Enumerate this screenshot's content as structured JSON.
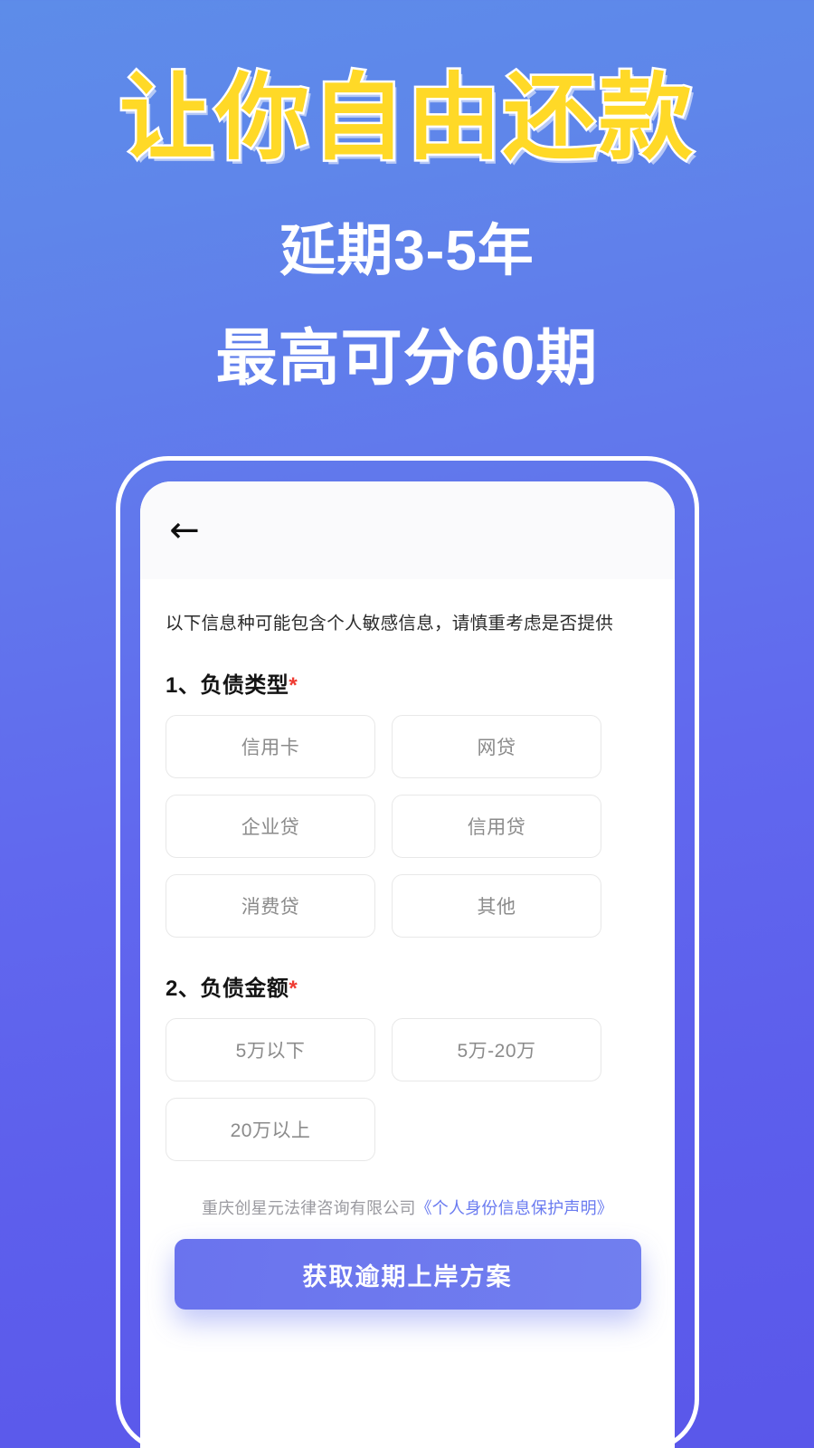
{
  "hero": {
    "headline": "让你自由还款",
    "subline_1": "延期3-5年",
    "subline_2": "最高可分60期",
    "headline_color": "#ffd927",
    "headline_stroke_color": "#ffffff",
    "subline_color": "#ffffff",
    "background_gradient_from": "#5d8ce9",
    "background_gradient_to": "#5a57ea"
  },
  "phone": {
    "header": {
      "back_icon": "←"
    },
    "notice": "以下信息种可能包含个人敏感信息，请慎重考虑是否提供",
    "sections": [
      {
        "title": "1、负债类型",
        "required_mark": "*",
        "options": [
          "信用卡",
          "网贷",
          "企业贷",
          "信用贷",
          "消费贷",
          "其他"
        ]
      },
      {
        "title": "2、负债金额",
        "required_mark": "*",
        "options": [
          "5万以下",
          "5万-20万",
          "20万以上"
        ]
      }
    ],
    "legal": {
      "company": "重庆创星元法律咨询有限公司",
      "link": "《个人身份信息保护声明》",
      "link_color": "#6a7bf0"
    },
    "cta_label": "获取逾期上岸方案",
    "cta_color": "#6a73ee"
  }
}
